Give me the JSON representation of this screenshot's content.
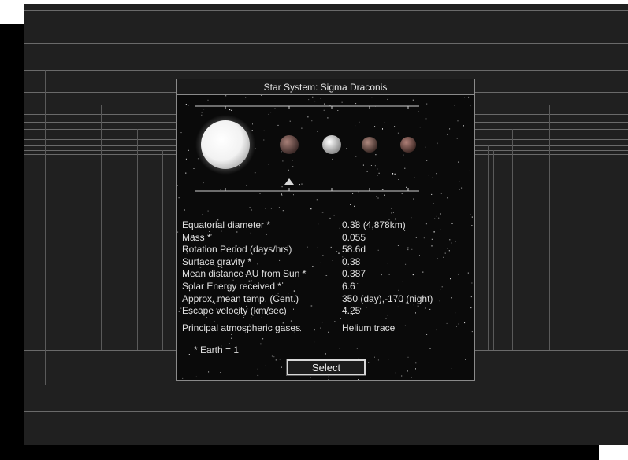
{
  "dialog": {
    "title": "Star System: Sigma Draconis",
    "select_label": "Select",
    "note": "* Earth = 1"
  },
  "planet_view": {
    "bodies": [
      {
        "name": "star-icon",
        "color": "#f0f0f0"
      },
      {
        "name": "planet-1-icon",
        "color": "#7a5a55"
      },
      {
        "name": "planet-2-icon",
        "color": "#d8d8d8"
      },
      {
        "name": "planet-3-icon",
        "color": "#8a6a62"
      },
      {
        "name": "planet-4-icon",
        "color": "#8a6560"
      }
    ],
    "selected_planet_index": 1
  },
  "stats": [
    {
      "label": "Equatorial diameter *",
      "value": "0.38 (4,878km)"
    },
    {
      "label": "Mass *",
      "value": "0.055"
    },
    {
      "label": "Rotation Period (days/hrs)",
      "value": "58.6d"
    },
    {
      "label": "Surface gravity *",
      "value": "0.38"
    },
    {
      "label": "Mean distance AU from Sun *",
      "value": "0.387"
    },
    {
      "label": "Solar Energy received *",
      "value": "6.6"
    },
    {
      "label": "Approx. mean temp. (Cent.)",
      "value": "350 (day),-170 (night)"
    },
    {
      "label": "Escape velocity (km/sec)",
      "value": "4.25"
    },
    {
      "label": "Principal atmospheric gases",
      "value": "Helium trace"
    }
  ]
}
